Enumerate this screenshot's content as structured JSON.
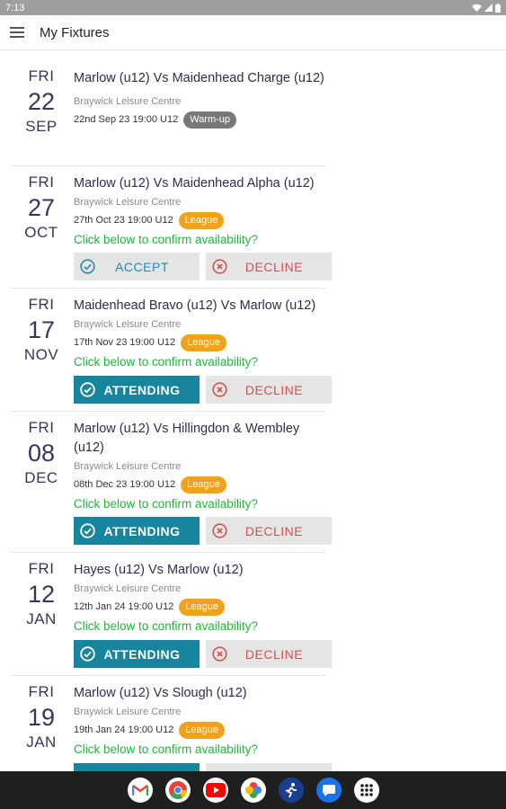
{
  "status_bar": {
    "time": "7:13"
  },
  "app_bar": {
    "title": "My Fixtures"
  },
  "fixtures": [
    {
      "day": "FRI",
      "date": "22",
      "month": "SEP",
      "title": "Marlow (u12) Vs Maidenhead Charge (u12)",
      "venue": "Braywick Leisure Centre",
      "meta": "22nd Sep 23 19:00 U12",
      "badge": "Warm-up"
    },
    {
      "day": "FRI",
      "date": "27",
      "month": "OCT",
      "title": "Marlow (u12) Vs Maidenhead Alpha  (u12)",
      "venue": "Braywick Leisure Centre",
      "meta": "27th Oct 23 19:00 U12",
      "badge": "League",
      "confirm": "Click below to confirm availability?",
      "primary_label": "ACCEPT",
      "decline_label": "DECLINE"
    },
    {
      "day": "FRI",
      "date": "17",
      "month": "NOV",
      "title": "Maidenhead Bravo (u12) Vs Marlow (u12)",
      "venue": "Braywick Leisure Centre",
      "meta": "17th Nov 23 19:00 U12",
      "badge": "League",
      "confirm": "Click below to confirm availability?",
      "primary_label": "ATTENDING",
      "decline_label": "DECLINE"
    },
    {
      "day": "FRI",
      "date": "08",
      "month": "DEC",
      "title": "Marlow (u12) Vs Hillingdon & Wembley (u12)",
      "venue": "Braywick Leisure Centre",
      "meta": "08th Dec 23 19:00 U12",
      "badge": "League",
      "confirm": "Click below to confirm availability?",
      "primary_label": "ATTENDING",
      "decline_label": "DECLINE"
    },
    {
      "day": "FRI",
      "date": "12",
      "month": "JAN",
      "title": "Hayes (u12) Vs Marlow (u12)",
      "venue": "Braywick Leisure Centre",
      "meta": "12th Jan 24 19:00 U12",
      "badge": "League",
      "confirm": "Click below to confirm availability?",
      "primary_label": "ATTENDING",
      "decline_label": "DECLINE"
    },
    {
      "day": "FRI",
      "date": "19",
      "month": "JAN",
      "title": "Marlow (u12) Vs Slough (u12)",
      "venue": "Braywick Leisure Centre",
      "meta": "19th Jan 24 19:00 U12",
      "badge": "League",
      "confirm": "Click below to confirm availability?"
    }
  ],
  "dock": {
    "apps": [
      "gmail-icon",
      "chrome-icon",
      "youtube-icon",
      "photos-icon",
      "fitness-icon",
      "messages-icon",
      "app-drawer-icon"
    ]
  },
  "colors": {
    "accent": "#17859e",
    "league": "#f0a21c",
    "warmup": "#787878",
    "confirm": "#21b43a",
    "decline": "#d25151"
  }
}
